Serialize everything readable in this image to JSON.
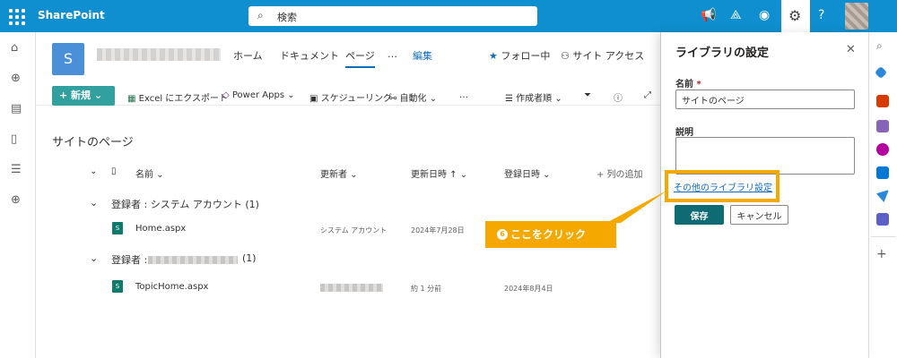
{
  "topbar": {
    "brand": "SharePoint",
    "search_placeholder": "検索",
    "accent": "#0f8fcf"
  },
  "site": {
    "logo_letter": "S",
    "nav": [
      {
        "label": "ホーム"
      },
      {
        "label": "ドキュメント"
      },
      {
        "label": "ページ"
      },
      {
        "label": "…"
      },
      {
        "label": "編集"
      }
    ],
    "follow_label": "フォロー中",
    "access_label": "サイト アクセス"
  },
  "commandbar": {
    "new_label": "+ 新規",
    "excel_label": "Excel にエクスポート",
    "powerapps_label": "Power Apps",
    "schedule_label": "スケジューリング",
    "automate_label": "自動化",
    "more": "…",
    "sort_label": "作成者順"
  },
  "list": {
    "title": "サイトのページ",
    "columns": [
      "名前",
      "更新者",
      "更新日時 ↑",
      "登録日時",
      "+ 列の追加"
    ],
    "groups": [
      {
        "label": "登録者 : システム アカウント (1)",
        "rows": [
          {
            "name": "Home.aspx",
            "modified_by": "システム アカウント",
            "modified": "2024年7月28日",
            "created": ""
          }
        ]
      },
      {
        "label_prefix": "登録者 :",
        "label_suffix": "(1)",
        "rows": [
          {
            "name": "TopicHome.aspx",
            "modified_by": "",
            "modified": "約 1 分前",
            "created": "2024年8月4日"
          }
        ]
      }
    ]
  },
  "panel": {
    "title": "ライブラリの設定",
    "name_label": "名前",
    "name_required": "*",
    "name_value": "サイトのページ",
    "desc_label": "説明",
    "desc_value": "",
    "more_settings_link": "その他のライブラリ設定",
    "save_label": "保存",
    "cancel_label": "キャンセル"
  },
  "callout": {
    "number": "6",
    "text": "ここをクリック",
    "color": "#f5a800"
  }
}
